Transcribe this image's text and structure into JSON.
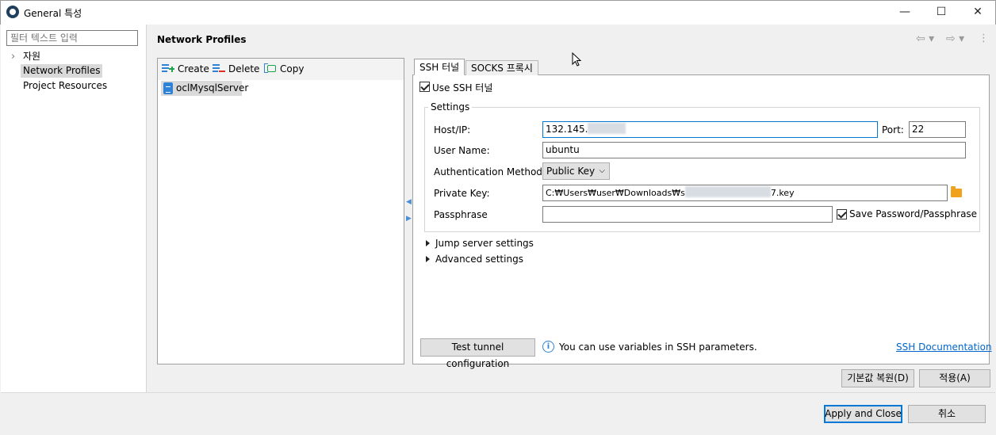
{
  "window": {
    "title": "General 특성",
    "minimize_glyph": "—",
    "maximize_glyph": "☐",
    "close_glyph": "✕"
  },
  "sidebar": {
    "filter_placeholder": "필터 텍스트 입력",
    "items": [
      {
        "label": "자원",
        "expander": "›"
      },
      {
        "label": "Network Profiles",
        "selected": true
      },
      {
        "label": "Project Resources"
      }
    ]
  },
  "header": {
    "title": "Network Profiles",
    "icons": [
      "back-arrow-icon",
      "forward-arrow-icon",
      "view-menu-icon"
    ]
  },
  "profiles": {
    "toolbar": {
      "create": "Create",
      "delete": "Delete",
      "copy": "Copy"
    },
    "items": [
      {
        "name": "oclMysqlServer",
        "selected": true
      }
    ]
  },
  "tabs": [
    {
      "label": "SSH 터널",
      "active": true
    },
    {
      "label": "SOCKS 프록시",
      "active": false
    }
  ],
  "ssh": {
    "use_ssh_label": "Use SSH 터널",
    "use_ssh_checked": true,
    "settings_title": "Settings",
    "host_label": "Host/IP:",
    "host_value": "132.145.",
    "port_label": "Port:",
    "port_value": "22",
    "user_label": "User Name:",
    "user_value": "ubuntu",
    "auth_label": "Authentication Method:",
    "auth_value": "Public Key",
    "key_label": "Private Key:",
    "key_value_prefix": "C:₩Users₩user₩Downloads₩s",
    "key_value_suffix": "7.key",
    "pass_label": "Passphrase",
    "pass_value": "",
    "save_pass_label": "Save Password/Passphrase",
    "save_pass_checked": true,
    "jump_label": "Jump server settings",
    "advanced_label": "Advanced settings",
    "test_button": "Test tunnel configuration",
    "info_text": "You can use variables in SSH parameters.",
    "doc_link": "SSH Documentation"
  },
  "actions": {
    "restore_defaults": "기본값 복원(D)",
    "apply": "적용(A)",
    "apply_close": "Apply and Close",
    "cancel": "취소"
  },
  "colors": {
    "accent": "#0078d7",
    "link": "#0066cc",
    "icon_blue": "#2f82d6",
    "folder": "#f0a21c",
    "create_green": "#1aa34a",
    "delete_red": "#d93025"
  }
}
